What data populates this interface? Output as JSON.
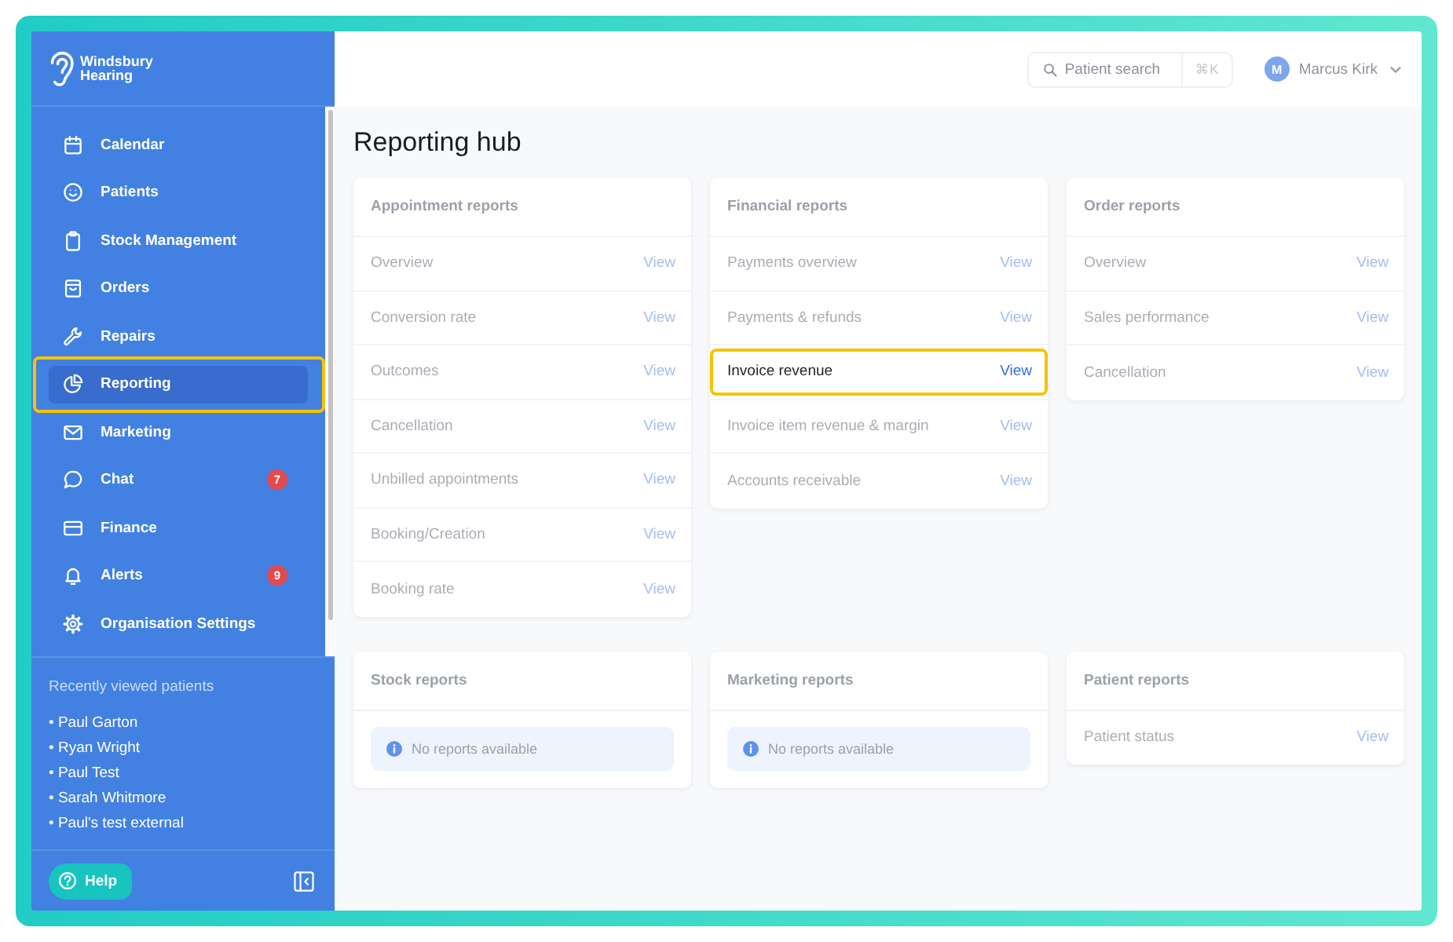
{
  "brand": {
    "name": "Windsbury Hearing"
  },
  "sidebar": {
    "nav": [
      {
        "label": "Calendar",
        "selected": false,
        "highlighted": false
      },
      {
        "label": "Patients",
        "selected": false,
        "highlighted": false
      },
      {
        "label": "Stock Management",
        "selected": false,
        "highlighted": false
      },
      {
        "label": "Orders",
        "selected": false,
        "highlighted": false
      },
      {
        "label": "Repairs",
        "selected": false,
        "highlighted": false
      },
      {
        "label": "Reporting",
        "selected": true,
        "highlighted": true
      },
      {
        "label": "Marketing",
        "selected": false,
        "highlighted": false
      },
      {
        "label": "Chat",
        "selected": false,
        "highlighted": false,
        "badge": "7"
      },
      {
        "label": "Finance",
        "selected": false,
        "highlighted": false
      },
      {
        "label": "Alerts",
        "selected": false,
        "highlighted": false,
        "badge": "9"
      },
      {
        "label": "Organisation Settings",
        "selected": false,
        "highlighted": false
      }
    ],
    "recent_patients": {
      "title": "Recently viewed patients",
      "items": [
        "• Paul Garton",
        "• Ryan Wright",
        "• Paul Test",
        "• Sarah Whitmore",
        "• Paul's test external"
      ]
    },
    "help_button": {
      "label": "Help"
    }
  },
  "topbar": {
    "search": {
      "placeholder": "Patient search",
      "shortcut": "⌘K"
    },
    "user": {
      "initial": "M",
      "name": "Marcus Kirk"
    }
  },
  "page_title": "Reporting hub",
  "report_groups": [
    {
      "kind": "list",
      "title": "Appointment reports",
      "reports": [
        {
          "name": "Overview",
          "action": "View",
          "highlighted": false
        },
        {
          "name": "Conversion rate",
          "action": "View",
          "highlighted": false
        },
        {
          "name": "Outcomes",
          "action": "View",
          "highlighted": false
        },
        {
          "name": "Cancellation",
          "action": "View",
          "highlighted": false
        },
        {
          "name": "Unbilled appointments",
          "action": "View",
          "highlighted": false
        },
        {
          "name": "Booking/Creation",
          "action": "View",
          "highlighted": false
        },
        {
          "name": "Booking rate",
          "action": "View",
          "highlighted": false
        }
      ]
    },
    {
      "kind": "list",
      "title": "Financial reports",
      "reports": [
        {
          "name": "Payments overview",
          "action": "View",
          "highlighted": false
        },
        {
          "name": "Payments & refunds",
          "action": "View",
          "highlighted": false
        },
        {
          "name": "Invoice revenue",
          "action": "View",
          "highlighted": true
        },
        {
          "name": "Invoice item revenue & margin",
          "action": "View",
          "highlighted": false
        },
        {
          "name": "Accounts receivable",
          "action": "View",
          "highlighted": false
        }
      ]
    },
    {
      "kind": "list",
      "title": "Order reports",
      "reports": [
        {
          "name": "Overview",
          "action": "View",
          "highlighted": false
        },
        {
          "name": "Sales performance",
          "action": "View",
          "highlighted": false
        },
        {
          "name": "Cancellation",
          "action": "View",
          "highlighted": false
        }
      ]
    },
    {
      "kind": "empty",
      "title": "Stock reports",
      "message": "No reports available"
    },
    {
      "kind": "empty",
      "title": "Marketing reports",
      "message": "No reports available"
    },
    {
      "kind": "list",
      "title": "Patient reports",
      "reports": [
        {
          "name": "Patient status",
          "action": "View",
          "highlighted": false
        }
      ]
    }
  ]
}
